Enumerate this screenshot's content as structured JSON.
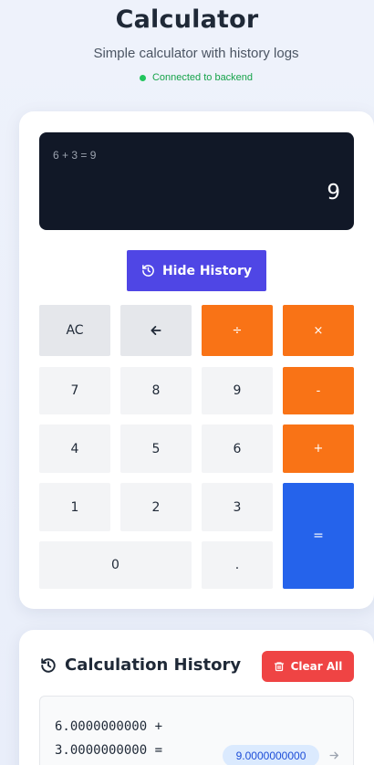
{
  "header": {
    "title": "Calculator",
    "subtitle": "Simple calculator with history logs",
    "status": "Connected to backend"
  },
  "display": {
    "expression": "6 + 3 = 9",
    "value": "9"
  },
  "toggle_history": {
    "label": "Hide History",
    "icon": "history-icon"
  },
  "keys": {
    "ac": "AC",
    "backspace": "🡐",
    "divide": "÷",
    "multiply": "×",
    "seven": "7",
    "eight": "8",
    "nine": "9",
    "minus": "-",
    "four": "4",
    "five": "5",
    "six": "6",
    "plus": "+",
    "one": "1",
    "two": "2",
    "three": "3",
    "equals": "=",
    "zero": "0",
    "decimal": "."
  },
  "history": {
    "title": "Calculation History",
    "clear_label": "Clear All",
    "items": [
      {
        "expression_line1": "6.0000000000 +",
        "expression_line2": "3.0000000000 =",
        "result": "9.0000000000"
      }
    ]
  },
  "colors": {
    "display_bg": "#111827",
    "primary": "#4f46e5",
    "operator": "#f97316",
    "equals": "#2563eb",
    "danger": "#ef4444",
    "status": "#16a34a"
  }
}
